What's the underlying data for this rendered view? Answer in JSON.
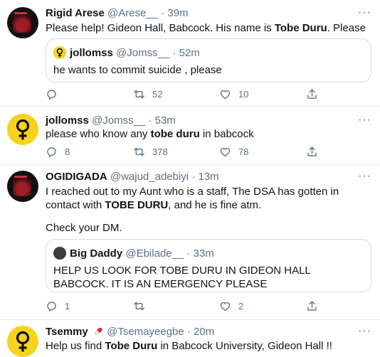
{
  "tweets": [
    {
      "name": "Rigid Arese",
      "handle": "@Arese__",
      "time": "· 39m",
      "text": [
        "Please help! Gideon Hall, Babcock. His name is ",
        "Tobe Duru",
        ". Please"
      ],
      "quote": {
        "name": "jollomss",
        "handle": "@Jomss__",
        "time": "· 52m",
        "text": "he wants to commit suicide , please"
      },
      "replies": "",
      "retweets": "52",
      "likes": "10"
    },
    {
      "name": "jollomss",
      "handle": "@Jomss__",
      "time": "· 53m",
      "text": [
        "please who know any ",
        "tobe duru",
        " in babcock"
      ],
      "replies": "8",
      "retweets": "378",
      "likes": "78"
    },
    {
      "name": "OGIDIGADA",
      "handle": "@wajud_adebiyi",
      "time": "· 13m",
      "text": [
        "I reached out to my Aunt who is a staff, The DSA has gotten in contact with ",
        "TOBE DURU",
        ", and he is fine atm."
      ],
      "text2": "Check your DM.",
      "quote": {
        "name": "Big Daddy",
        "handle": "@Ebilade__",
        "time": "· 33m",
        "text": "HELP US LOOK FOR TOBE DURU IN GIDEON HALL BABCOCK. IT IS AN EMERGENCY PLEASE"
      },
      "replies": "1",
      "retweets": "",
      "likes": "2"
    },
    {
      "name": "Tsemmy",
      "name_emoji": "pill-emoji",
      "handle": "@Tsemayeegbe",
      "time": "· 20m",
      "text": [
        "Help us find ",
        "Tobe Duru",
        " in Babcock University, Gideon Hall !!"
      ]
    }
  ],
  "more_label": "···",
  "icons": {
    "reply": "reply-icon",
    "retweet": "retweet-icon",
    "like": "heart-icon",
    "share": "share-icon",
    "more": "more-icon"
  },
  "colors": {
    "text": "#0f1419",
    "muted": "#5b7083",
    "border": "#e6ecf0",
    "avatar_yellow": "#f7d31e"
  }
}
